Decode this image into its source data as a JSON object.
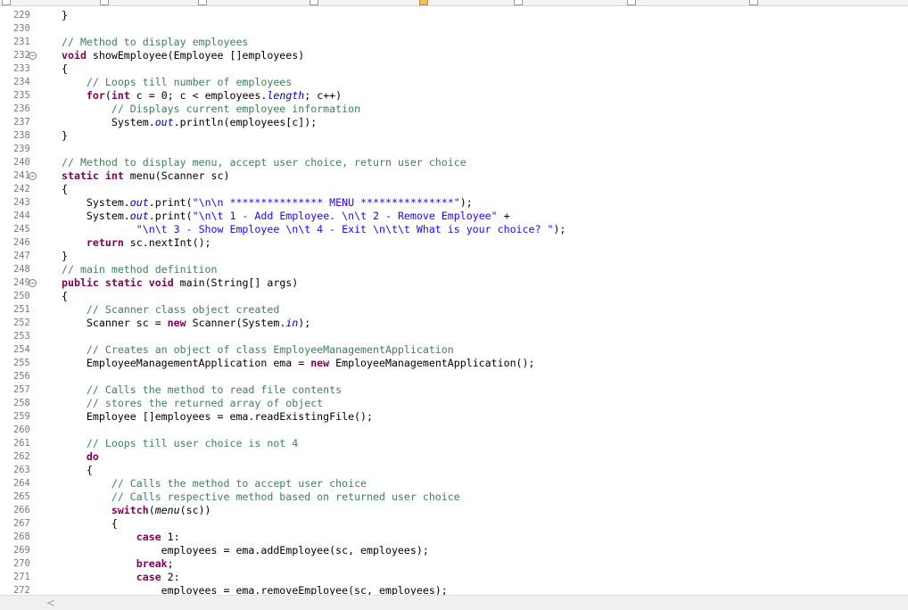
{
  "editor": {
    "language": "java",
    "first_line": 229,
    "lines": [
      {
        "n": "229",
        "fold": false,
        "t": [
          [
            "}",
            ""
          ]
        ]
      },
      {
        "n": "230",
        "fold": false,
        "t": []
      },
      {
        "n": "231",
        "fold": false,
        "t": [
          [
            "// Method to display employees",
            "cm"
          ]
        ]
      },
      {
        "n": "232",
        "fold": true,
        "t": [
          [
            "void",
            "kw"
          ],
          [
            " showEmployee(Employee []employees)",
            ""
          ]
        ]
      },
      {
        "n": "233",
        "fold": false,
        "t": [
          [
            "{",
            ""
          ]
        ]
      },
      {
        "n": "234",
        "fold": false,
        "t": [
          [
            "    ",
            ""
          ],
          [
            "// Loops till number of employees",
            "cm"
          ]
        ]
      },
      {
        "n": "235",
        "fold": false,
        "t": [
          [
            "    ",
            ""
          ],
          [
            "for",
            "kw"
          ],
          [
            "(",
            ""
          ],
          [
            "int",
            "kw"
          ],
          [
            " c = 0; c < employees.",
            ""
          ],
          [
            "length",
            "fld"
          ],
          [
            "; c++)",
            ""
          ]
        ]
      },
      {
        "n": "236",
        "fold": false,
        "t": [
          [
            "        ",
            ""
          ],
          [
            "// Displays current employee information",
            "cm"
          ]
        ]
      },
      {
        "n": "237",
        "fold": false,
        "t": [
          [
            "        System.",
            ""
          ],
          [
            "out",
            "fld"
          ],
          [
            ".println(employees[c]);",
            ""
          ]
        ]
      },
      {
        "n": "238",
        "fold": false,
        "t": [
          [
            "}",
            ""
          ]
        ]
      },
      {
        "n": "239",
        "fold": false,
        "t": []
      },
      {
        "n": "240",
        "fold": false,
        "t": [
          [
            "// Method to display menu, accept user choice, return user choice",
            "cm"
          ]
        ]
      },
      {
        "n": "241",
        "fold": true,
        "t": [
          [
            "static",
            "kw"
          ],
          [
            " ",
            ""
          ],
          [
            "int",
            "kw"
          ],
          [
            " menu(Scanner sc)",
            ""
          ]
        ]
      },
      {
        "n": "242",
        "fold": false,
        "t": [
          [
            "{",
            ""
          ]
        ]
      },
      {
        "n": "243",
        "fold": false,
        "t": [
          [
            "    System.",
            ""
          ],
          [
            "out",
            "fld"
          ],
          [
            ".print(",
            ""
          ],
          [
            "\"\\n\\n *************** MENU ***************\"",
            "str"
          ],
          [
            ");",
            ""
          ]
        ]
      },
      {
        "n": "244",
        "fold": false,
        "t": [
          [
            "    System.",
            ""
          ],
          [
            "out",
            "fld"
          ],
          [
            ".print(",
            ""
          ],
          [
            "\"\\n\\t 1 - Add Employee. \\n\\t 2 - Remove Employee\"",
            "str"
          ],
          [
            " +",
            ""
          ]
        ]
      },
      {
        "n": "245",
        "fold": false,
        "t": [
          [
            "            ",
            ""
          ],
          [
            "\"\\n\\t 3 - Show Employee \\n\\t 4 - Exit \\n\\t\\t What is your choice? \"",
            "str"
          ],
          [
            ");",
            ""
          ]
        ]
      },
      {
        "n": "246",
        "fold": false,
        "t": [
          [
            "    ",
            ""
          ],
          [
            "return",
            "kw"
          ],
          [
            " sc.nextInt();",
            ""
          ]
        ]
      },
      {
        "n": "247",
        "fold": false,
        "t": [
          [
            "}",
            ""
          ]
        ]
      },
      {
        "n": "248",
        "fold": false,
        "t": [
          [
            "// main method definition",
            "cm"
          ]
        ]
      },
      {
        "n": "249",
        "fold": true,
        "t": [
          [
            "public",
            "kw"
          ],
          [
            " ",
            ""
          ],
          [
            "static",
            "kw"
          ],
          [
            " ",
            ""
          ],
          [
            "void",
            "kw"
          ],
          [
            " main(String[] args)",
            ""
          ]
        ]
      },
      {
        "n": "250",
        "fold": false,
        "t": [
          [
            "{",
            ""
          ]
        ]
      },
      {
        "n": "251",
        "fold": false,
        "t": [
          [
            "    ",
            ""
          ],
          [
            "// Scanner class object created",
            "cm"
          ]
        ]
      },
      {
        "n": "252",
        "fold": false,
        "t": [
          [
            "    Scanner sc = ",
            ""
          ],
          [
            "new",
            "kw"
          ],
          [
            " Scanner(System.",
            ""
          ],
          [
            "in",
            "fld"
          ],
          [
            ");",
            ""
          ]
        ]
      },
      {
        "n": "253",
        "fold": false,
        "t": []
      },
      {
        "n": "254",
        "fold": false,
        "t": [
          [
            "    ",
            ""
          ],
          [
            "// Creates an object of class EmployeeManagementApplication",
            "cm"
          ]
        ]
      },
      {
        "n": "255",
        "fold": false,
        "t": [
          [
            "    EmployeeManagementApplication ema = ",
            ""
          ],
          [
            "new",
            "kw"
          ],
          [
            " EmployeeManagementApplication();",
            ""
          ]
        ]
      },
      {
        "n": "256",
        "fold": false,
        "t": []
      },
      {
        "n": "257",
        "fold": false,
        "t": [
          [
            "    ",
            ""
          ],
          [
            "// Calls the method to read file contents",
            "cm"
          ]
        ]
      },
      {
        "n": "258",
        "fold": false,
        "t": [
          [
            "    ",
            ""
          ],
          [
            "// stores the returned array of object",
            "cm"
          ]
        ]
      },
      {
        "n": "259",
        "fold": false,
        "t": [
          [
            "    Employee []employees = ema.readExistingFile();",
            ""
          ]
        ]
      },
      {
        "n": "260",
        "fold": false,
        "t": []
      },
      {
        "n": "261",
        "fold": false,
        "t": [
          [
            "    ",
            ""
          ],
          [
            "// Loops till user choice is not 4",
            "cm"
          ]
        ]
      },
      {
        "n": "262",
        "fold": false,
        "t": [
          [
            "    ",
            ""
          ],
          [
            "do",
            "kw"
          ]
        ]
      },
      {
        "n": "263",
        "fold": false,
        "t": [
          [
            "    {",
            ""
          ]
        ]
      },
      {
        "n": "264",
        "fold": false,
        "t": [
          [
            "        ",
            ""
          ],
          [
            "// Calls the method to accept user choice",
            "cm"
          ]
        ]
      },
      {
        "n": "265",
        "fold": false,
        "t": [
          [
            "        ",
            ""
          ],
          [
            "// Calls respective method based on returned user choice",
            "cm"
          ]
        ]
      },
      {
        "n": "266",
        "fold": false,
        "t": [
          [
            "        ",
            ""
          ],
          [
            "switch",
            "kw"
          ],
          [
            "(",
            ""
          ],
          [
            "menu",
            "it"
          ],
          [
            "(sc))",
            ""
          ]
        ]
      },
      {
        "n": "267",
        "fold": false,
        "t": [
          [
            "        {",
            ""
          ]
        ]
      },
      {
        "n": "268",
        "fold": false,
        "t": [
          [
            "            ",
            ""
          ],
          [
            "case",
            "kw"
          ],
          [
            " 1:",
            ""
          ]
        ]
      },
      {
        "n": "269",
        "fold": false,
        "t": [
          [
            "                employees = ema.addEmployee(sc, employees);",
            ""
          ]
        ]
      },
      {
        "n": "270",
        "fold": false,
        "t": [
          [
            "            ",
            ""
          ],
          [
            "break",
            "kw"
          ],
          [
            ";",
            ""
          ]
        ]
      },
      {
        "n": "271",
        "fold": false,
        "t": [
          [
            "            ",
            ""
          ],
          [
            "case",
            "kw"
          ],
          [
            " 2:",
            ""
          ]
        ]
      },
      {
        "n": "272",
        "fold": false,
        "t": [
          [
            "                employees = ema.removeEmployee(sc, employees);",
            ""
          ]
        ]
      }
    ]
  },
  "scrollbar": {
    "left_arrow": "<"
  },
  "icons": {
    "fold": "minus-circle-icon",
    "scroll_left": "chevron-left-icon"
  }
}
